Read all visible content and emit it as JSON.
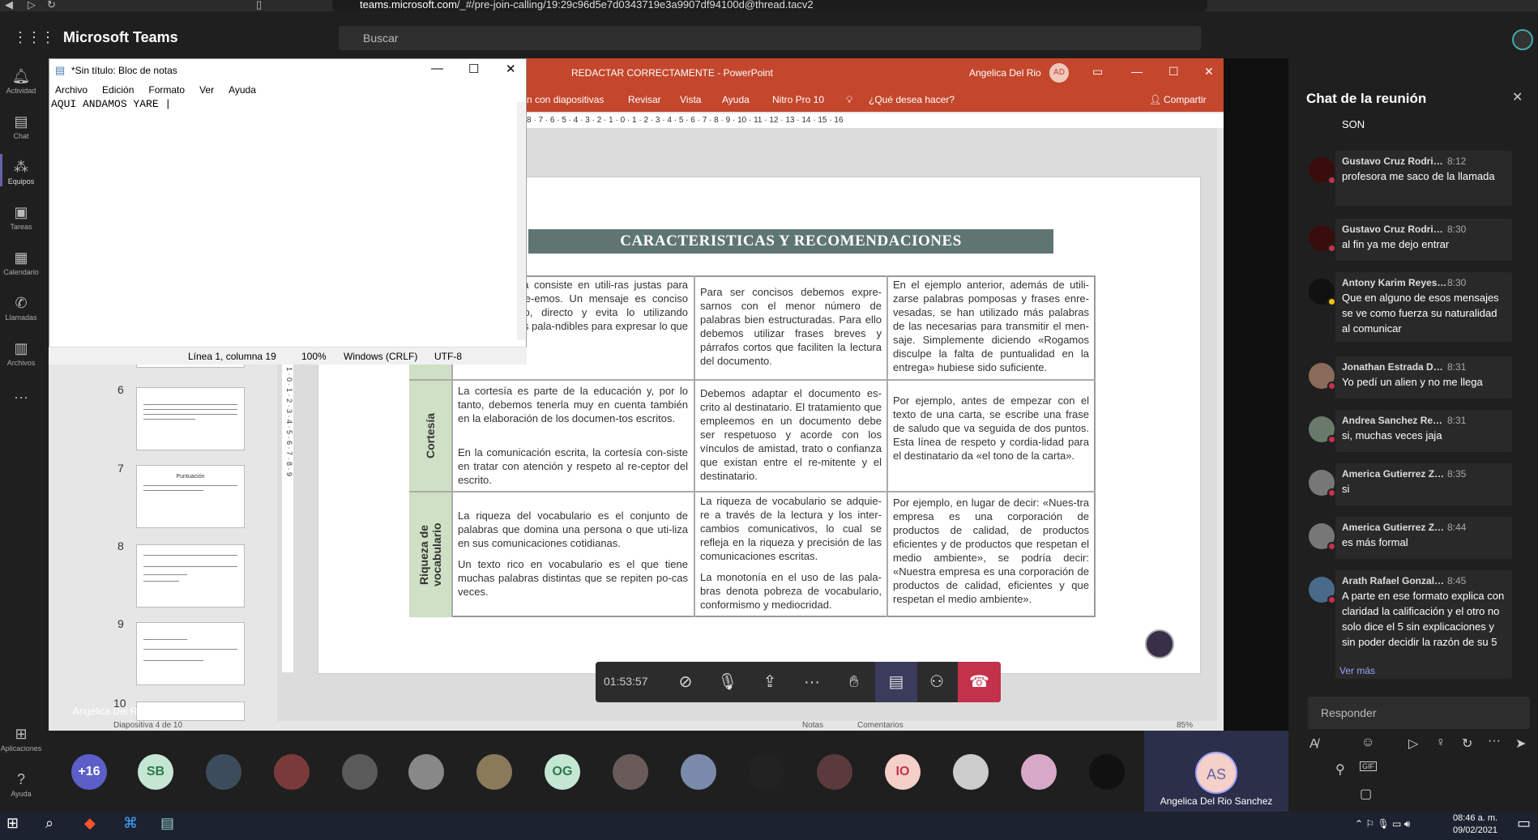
{
  "browser": {
    "url_domain": "teams.microsoft.com",
    "url_path": "/_#/pre-join-calling/19:29c96d5e7d0343719e3a9907df94100d@thread.tacv2"
  },
  "teams": {
    "title": "Microsoft Teams",
    "search_placeholder": "Buscar",
    "rail": [
      {
        "label": "Actividad",
        "icon": "bell-icon"
      },
      {
        "label": "Chat",
        "icon": "chat-icon"
      },
      {
        "label": "Equipos",
        "icon": "teams-icon"
      },
      {
        "label": "Tareas",
        "icon": "tasks-icon"
      },
      {
        "label": "Calendario",
        "icon": "calendar-icon"
      },
      {
        "label": "Llamadas",
        "icon": "phone-icon"
      },
      {
        "label": "Archivos",
        "icon": "files-icon"
      },
      {
        "label": "Aplicaciones",
        "icon": "apps-icon"
      },
      {
        "label": "Ayuda",
        "icon": "help-icon"
      }
    ],
    "accent": "#6264a7"
  },
  "notepad": {
    "title": "*Sin título: Bloc de notas",
    "menu": [
      "Archivo",
      "Edición",
      "Formato",
      "Ver",
      "Ayuda"
    ],
    "content": "AQUI ANDAMOS YARE |",
    "status": {
      "position": "Línea 1, columna 19",
      "zoom": "100%",
      "eol": "Windows (CRLF)",
      "encoding": "UTF-8"
    }
  },
  "powerpoint": {
    "title": "REDACTAR CORRECTAMENTE  -  PowerPoint",
    "user": "Angelica Del Rio",
    "user_initials": "AD",
    "ribbon": [
      "n con diapositivas",
      "Revisar",
      "Vista",
      "Ayuda",
      "Nitro Pro 10",
      "¿Qué desea hacer?",
      "Compartir"
    ],
    "brand_color": "#c4462c",
    "ruler": "8 · 7 · 6 · 5 · 4 · 3 · 2 · 1 · 0 · 1 · 2 · 3 · 4 · 5 · 6 · 7 · 8 · 9 · 10 · 11 · 12 · 13 · 14 · 15 · 16",
    "thumbs": [
      "6",
      "7",
      "8",
      "9",
      "10"
    ],
    "thumb7_title": "Puntuación",
    "status_slide": "Diapositiva 4 de 10",
    "status_notes": "Notas",
    "status_comments": "Comentarios",
    "status_zoom": "85%",
    "slide": {
      "heading": "CARACTERISTICAS Y RECOMENDACIONES",
      "rows": [
        {
          "label": "",
          "c1": "en la escritura consiste en utili-ras justas para transmitir aque-emos. Un mensaje es conciso breve, preciso, directo y evita lo utilizando únicamente las pala-ndibles para expresar lo que se pretende.",
          "c2": "Para ser concisos debemos expre-sarnos con el menor número de palabras bien estructuradas. Para ello debemos utilizar frases breves y párrafos cortos que faciliten la lectura del documento.",
          "c3": "En el ejemplo anterior, además de utili-zarse palabras pomposas y frases enre-vesadas, se han utilizado más palabras de las necesarias para transmitir el men-saje. Simplemente diciendo «Rogamos disculpe la falta de puntualidad en la entrega» hubiese sido suficiente."
        },
        {
          "label": "Cortesía",
          "c1": "La cortesía es parte de la educación y, por lo tanto, debemos tenerla muy en cuenta también en la elaboración de los documen-tos escritos.",
          "c1b": "En la comunicación escrita, la cortesía con-siste en tratar con atención y respeto al re-ceptor del escrito.",
          "c2": "Debemos adaptar el documento es-crito al destinatario. El tratamiento que empleemos en un documento debe ser respetuoso y acorde con los vínculos de amistad, trato o confianza que existan entre el re-mitente y el destinatario.",
          "c3": "Por ejemplo, antes de empezar con el texto de una carta, se escribe una frase de saludo que va seguida de dos puntos. Esta línea de respeto y cordia-lidad para el destinatario da «el tono de la carta»."
        },
        {
          "label": "Riqueza de vocabulario",
          "c1": "La riqueza del vocabulario es el conjunto de palabras que domina una persona o que uti-liza en sus comunicaciones cotidianas.",
          "c1b": "Un texto rico en vocabulario es el que tiene muchas palabras distintas que se repiten po-cas veces.",
          "c2": "La riqueza de vocabulario se adquie-re a través de la lectura y los inter-cambios comunicativos, lo cual se refleja en la riqueza y precisión de las comunicaciones escritas.",
          "c2b": "La monotonía en el uso de las pala-bras denota pobreza de vocabulario, conformismo y mediocridad.",
          "c3": "Por ejemplo, en lugar de decir: «Nues-tra empresa es una corporación de productos de calidad, de productos eficientes y de productos que respetan el medio ambiente», se podría decir: «Nuestra empresa es una corporación de productos de calidad, eficientes y que respetan el medio ambiente»."
        }
      ]
    }
  },
  "call": {
    "timer": "01:53:57",
    "presenter": "Angelica Del Rio Sanchez"
  },
  "chat": {
    "title": "Chat de la reunión",
    "partial_top": "SON",
    "messages": [
      {
        "name": "Gustavo Cruz Rodriguez",
        "time": "8:12",
        "text": "profesora me saco de la llamada"
      },
      {
        "name": "Gustavo Cruz Rodriguez",
        "time": "8:30",
        "text": "al fin ya me dejo entrar"
      },
      {
        "name": "Antony Karim Reyes Hernan...",
        "time": "8:30",
        "text": "Que en alguno de esos mensajes se ve como fuerza  su naturalidad al comunicar"
      },
      {
        "name": "Jonathan Estrada De Jesus",
        "time": "8:31",
        "text": "Yo pedí un alien y no me llega"
      },
      {
        "name": "Andrea Sanchez Reyes",
        "time": "8:31",
        "text": "si, muchas veces jaja"
      },
      {
        "name": "America Gutierrez Zumaya",
        "time": "8:35",
        "text": "si"
      },
      {
        "name": "America Gutierrez Zumaya",
        "time": "8:44",
        "text": "es más formal"
      },
      {
        "name": "Arath Rafael Gonzalez Gonz...",
        "time": "8:45",
        "text": "A parte en ese formato explica con claridad la calificación y el otro no solo dice el 5 sin explicaciones y sin poder decidir la razón de su 5"
      }
    ],
    "more": "Ver más",
    "reply_placeholder": "Responder"
  },
  "participants": {
    "overflow": "+16",
    "initials": [
      "SB",
      "OG",
      "IO"
    ],
    "self_initials": "AS",
    "self_name": "Angelica Del Rio Sanchez"
  },
  "taskbar": {
    "time": "08:46 a. m.",
    "date": "09/02/2021"
  }
}
